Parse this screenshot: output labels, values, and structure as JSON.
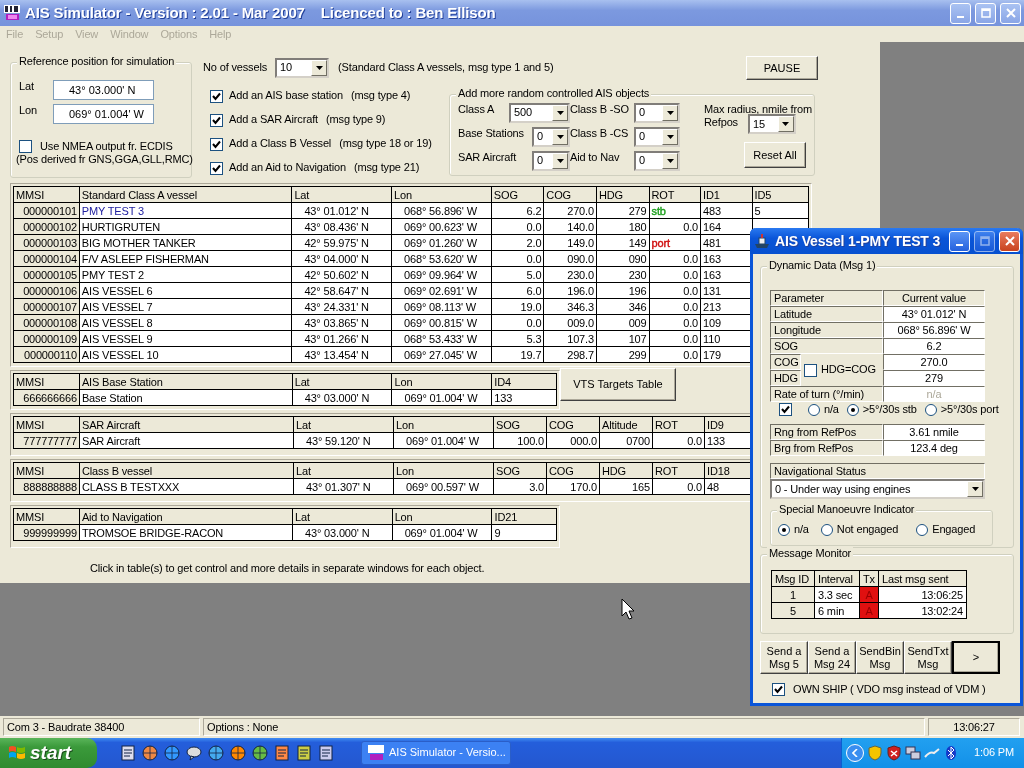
{
  "window": {
    "title": "AIS Simulator - Version : 2.01 - Mar 2007    Licenced to : Ben Ellison",
    "active": false
  },
  "menu": [
    {
      "label": "File",
      "disabled": true
    },
    {
      "label": "Setup",
      "disabled": true
    },
    {
      "label": "View",
      "disabled": true
    },
    {
      "label": "Window",
      "disabled": true
    },
    {
      "label": "Options",
      "disabled": true
    },
    {
      "label": "Help",
      "disabled": true
    }
  ],
  "reference": {
    "title": "Reference position for simulation",
    "lat_label": "Lat",
    "lat": "43° 03.000' N",
    "lon_label": "Lon",
    "lon": "069° 01.004' W",
    "nmea_label": "Use NMEA output fr. ECDIS",
    "nmea_checked": false,
    "note": "(Pos derived fr GNS,GGA,GLL,RMC)"
  },
  "vessels": {
    "label": "No of vessels",
    "value": "10",
    "note": "(Standard Class A vessels, msg type 1 and 5)"
  },
  "pause_button": "PAUSE",
  "options": [
    {
      "label": "Add an AIS base station",
      "note": "(msg type 4)",
      "checked": true
    },
    {
      "label": "Add a SAR Aircraft",
      "note": "(msg type 9)",
      "checked": true
    },
    {
      "label": "Add a Class B Vessel",
      "note": "(msg type 18 or 19)",
      "checked": true
    },
    {
      "label": "Add an Aid to Navigation",
      "note": "(msg type 21)",
      "checked": true
    }
  ],
  "random": {
    "title": "Add more random controlled AIS objects",
    "fields": [
      {
        "label": "Class A",
        "value": "500"
      },
      {
        "label": "Class B -SO",
        "value": "0"
      },
      {
        "label": "Base Stations",
        "value": "0"
      },
      {
        "label": "Class B -CS",
        "value": "0"
      },
      {
        "label": "SAR Aircraft",
        "value": "0"
      },
      {
        "label": "Aid to Nav",
        "value": "0"
      }
    ],
    "radius_label": "Max radius, nmile from",
    "refpos_label": "Refpos",
    "radius": "15",
    "reset_button": "Reset All"
  },
  "tables": [
    {
      "kind": "class_a",
      "columns": [
        "MMSI",
        "Standard Class A vessel",
        "Lat",
        "Lon",
        "SOG",
        "COG",
        "HDG",
        "ROT",
        "ID1",
        "ID5"
      ],
      "rows": [
        {
          "selected": true,
          "cells": [
            "000000101",
            "PMY TEST 3",
            "43° 01.012' N",
            "068° 56.896' W",
            "6.2",
            "270.0",
            "279",
            {
              "text": "stb",
              "color": "#1fa01f"
            },
            "483",
            "5"
          ]
        },
        {
          "selected": false,
          "cells": [
            "000000102",
            "HURTIGRUTEN",
            "43° 08.436' N",
            "069° 00.623' W",
            "0.0",
            "140.0",
            "180",
            "0.0",
            "164"
          ]
        },
        {
          "selected": false,
          "cells": [
            "000000103",
            "BIG MOTHER TANKER",
            "42° 59.975' N",
            "069° 01.260' W",
            "2.0",
            "149.0",
            "149",
            {
              "text": "port",
              "color": "#d01010"
            },
            "481"
          ]
        },
        {
          "selected": false,
          "cells": [
            "000000104",
            "F/V ASLEEP FISHERMAN",
            "43° 04.000' N",
            "068° 53.620' W",
            "0.0",
            "090.0",
            "090",
            "0.0",
            "163"
          ]
        },
        {
          "selected": false,
          "cells": [
            "000000105",
            "PMY TEST 2",
            "42° 50.602' N",
            "069° 09.964' W",
            "5.0",
            "230.0",
            "230",
            "0.0",
            "163"
          ]
        },
        {
          "selected": false,
          "cells": [
            "000000106",
            "AIS VESSEL 6",
            "42° 58.647' N",
            "069° 02.691' W",
            "6.0",
            "196.0",
            "196",
            "0.0",
            "131"
          ]
        },
        {
          "selected": false,
          "cells": [
            "000000107",
            "AIS VESSEL 7",
            "43° 24.331' N",
            "069° 08.113' W",
            "19.0",
            "346.3",
            "346",
            "0.0",
            "213"
          ]
        },
        {
          "selected": false,
          "cells": [
            "000000108",
            "AIS VESSEL 8",
            "43° 03.865' N",
            "069° 00.815' W",
            "0.0",
            "009.0",
            "009",
            "0.0",
            "109"
          ]
        },
        {
          "selected": false,
          "cells": [
            "000000109",
            "AIS VESSEL 9",
            "43° 01.266' N",
            "068° 53.433' W",
            "5.3",
            "107.3",
            "107",
            "0.0",
            "110"
          ]
        },
        {
          "selected": false,
          "cells": [
            "000000110",
            "AIS VESSEL 10",
            "43° 13.454' N",
            "069° 27.045' W",
            "19.7",
            "298.7",
            "299",
            "0.0",
            "179"
          ]
        }
      ]
    },
    {
      "kind": "short",
      "columns": [
        "MMSI",
        "AIS Base Station",
        "Lat",
        "Lon",
        "ID4"
      ],
      "rows": [
        {
          "selected": false,
          "cells": [
            "666666666",
            "Base Station",
            "43° 03.000' N",
            "069° 01.004' W",
            "133"
          ]
        }
      ]
    },
    {
      "kind": "long",
      "columns": [
        "MMSI",
        "SAR Aircraft",
        "Lat",
        "Lon",
        "SOG",
        "COG",
        "Altitude",
        "ROT",
        "ID9"
      ],
      "rows": [
        {
          "selected": false,
          "cells": [
            "777777777",
            "SAR Aircraft",
            "43° 59.120' N",
            "069° 01.004' W",
            "100.0",
            "000.0",
            "0700",
            "0.0",
            "133"
          ]
        }
      ]
    },
    {
      "kind": "long",
      "columns": [
        "MMSI",
        "Class B vessel",
        "Lat",
        "Lon",
        "SOG",
        "COG",
        "HDG",
        "ROT",
        "ID18"
      ],
      "rows": [
        {
          "selected": false,
          "cells": [
            "888888888",
            "CLASS B TESTXXX",
            "43° 01.307' N",
            "069° 00.597' W",
            "3.0",
            "170.0",
            "165",
            "0.0",
            "48"
          ]
        }
      ]
    },
    {
      "kind": "short",
      "columns": [
        "MMSI",
        "Aid to Navigation",
        "Lat",
        "Lon",
        "ID21"
      ],
      "rows": [
        {
          "selected": false,
          "cells": [
            "999999999",
            "TROMSOE BRIDGE-RACON",
            "43° 03.000' N",
            "069° 01.004' W",
            "9"
          ]
        }
      ]
    }
  ],
  "vts_button": "VTS Targets Table",
  "hint": "Click in table(s)  to get control and more details in separate windows for each object.",
  "vessel_window": {
    "title": "AIS Vessel 1-PMY TEST 3",
    "active": true,
    "dynamic_title": "Dynamic Data (Msg 1)",
    "param_header": [
      "Parameter",
      "Current value"
    ],
    "params": [
      {
        "kind": "full",
        "label": "Latitude",
        "value": "43° 01.012' N",
        "disabled": false
      },
      {
        "kind": "full",
        "label": "Longitude",
        "value": "068° 56.896' W",
        "disabled": false
      },
      {
        "kind": "full",
        "label": "SOG",
        "value": "6.2",
        "disabled": false
      },
      {
        "kind": "short",
        "label": "COG",
        "value": "270.0",
        "disabled": false
      },
      {
        "kind": "short",
        "label": "HDG",
        "value": "279",
        "disabled": false
      },
      {
        "kind": "full",
        "label": "Rate of turn (°/min)",
        "value": "n/a",
        "disabled": true
      }
    ],
    "hdg_cog": {
      "label": "HDG=COG",
      "checked": false
    },
    "rot_checked": true,
    "rot_options": [
      {
        "label": "n/a",
        "selected": false
      },
      {
        "label": ">5°/30s stb",
        "selected": true
      },
      {
        "label": ">5°/30s port",
        "selected": false
      }
    ],
    "ranges": [
      {
        "label": "Rng from RefPos",
        "value": "3.61 nmile"
      },
      {
        "label": "Brg from RefPos",
        "value": "123.4 deg"
      }
    ],
    "nav_status": {
      "label": "Navigational Status",
      "value": "0 - Under way using engines"
    },
    "smi": {
      "title": "Special Manoeuvre Indicator",
      "options": [
        {
          "label": "n/a",
          "selected": true
        },
        {
          "label": "Not engaged",
          "selected": false
        },
        {
          "label": "Engaged",
          "selected": false
        }
      ]
    },
    "monitor": {
      "title": "Message Monitor",
      "columns": [
        "Msg ID",
        "Interval",
        "Tx",
        "Last msg sent"
      ],
      "rows": [
        {
          "id": "1",
          "interval": "3.3 sec",
          "tx": "A",
          "last": "13:06:25"
        },
        {
          "id": "5",
          "interval": "6 min",
          "tx": "A",
          "last": "13:02:24"
        }
      ]
    },
    "buttons": [
      {
        "label": "Send a\nMsg 5",
        "default": false
      },
      {
        "label": "Send a\nMsg 24",
        "default": false
      },
      {
        "label": "SendBin\nMsg",
        "default": false
      },
      {
        "label": "SendTxt\nMsg",
        "default": false
      },
      {
        "label": ">",
        "default": true
      }
    ],
    "own_ship": {
      "label": "OWN SHIP ( VDO msg instead of VDM )",
      "checked": true
    }
  },
  "status_bar": [
    "Com 3  - Baudrate 38400",
    "Options : None",
    "13:06:27"
  ],
  "taskbar": {
    "start": "start",
    "task": "AIS Simulator - Versio...",
    "clock": "1:06 PM"
  }
}
